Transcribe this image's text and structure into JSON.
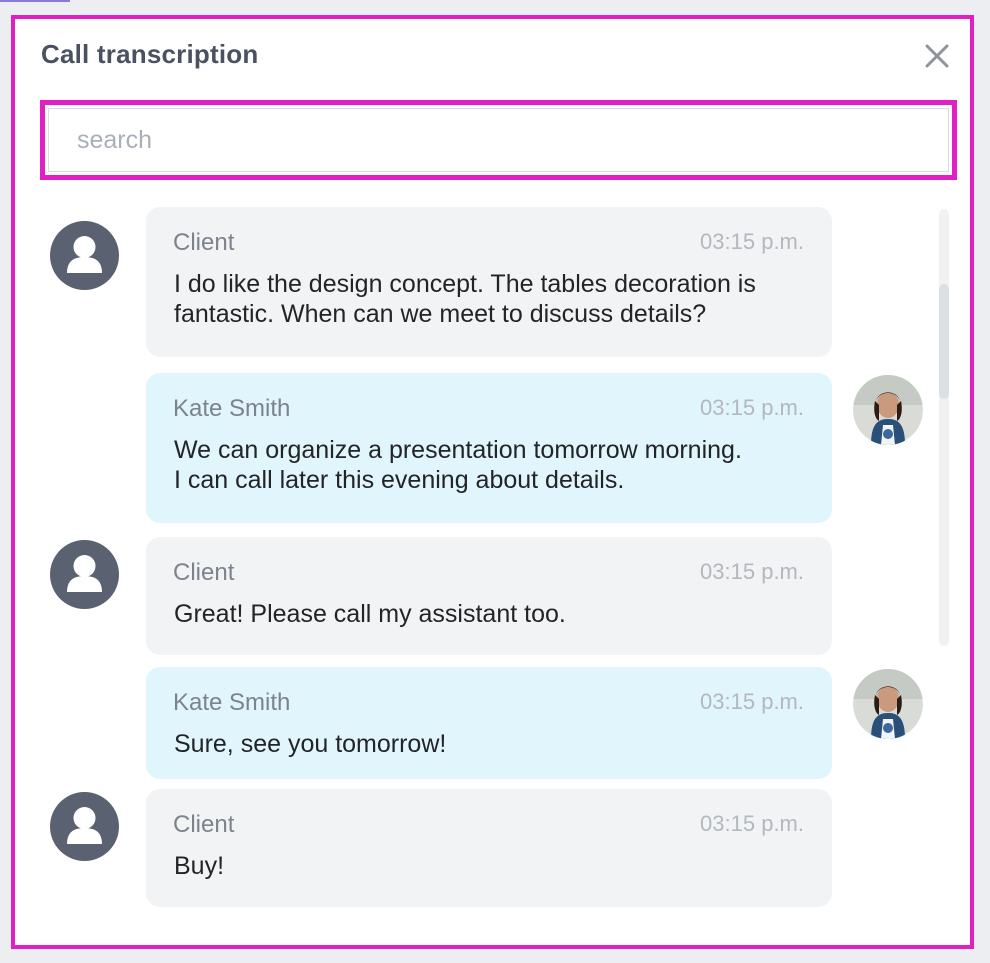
{
  "dialog": {
    "title": "Call transcription",
    "close_icon": "close-icon"
  },
  "search": {
    "placeholder": "search",
    "value": ""
  },
  "messages": [
    {
      "speaker": "Client",
      "time": "03:15 p.m.",
      "text": "I do like the design concept. The tables decoration is fantastic. When can we meet to discuss details?",
      "role": "client"
    },
    {
      "speaker": "Kate Smith",
      "time": "03:15 p.m.",
      "text": "We can organize a presentation tomorrow morning.\nI can call later this evening about details.",
      "role": "agent"
    },
    {
      "speaker": "Client",
      "time": "03:15 p.m.",
      "text": "Great! Please call my assistant too.",
      "role": "client"
    },
    {
      "speaker": "Kate Smith",
      "time": "03:15 p.m.",
      "text": "Sure, see you tomorrow!",
      "role": "agent"
    },
    {
      "speaker": "Client",
      "time": "03:15 p.m.",
      "text": "Buy!",
      "role": "client"
    }
  ],
  "colors": {
    "highlight_border": "#e020c2",
    "client_bubble": "#f2f3f5",
    "agent_bubble": "#e1f5fc",
    "client_avatar": "#5a6170",
    "title_text": "#4a5160"
  },
  "icons": {
    "client_avatar": "user-silhouette-icon",
    "agent_avatar": "agent-photo-avatar",
    "close": "close-icon"
  }
}
